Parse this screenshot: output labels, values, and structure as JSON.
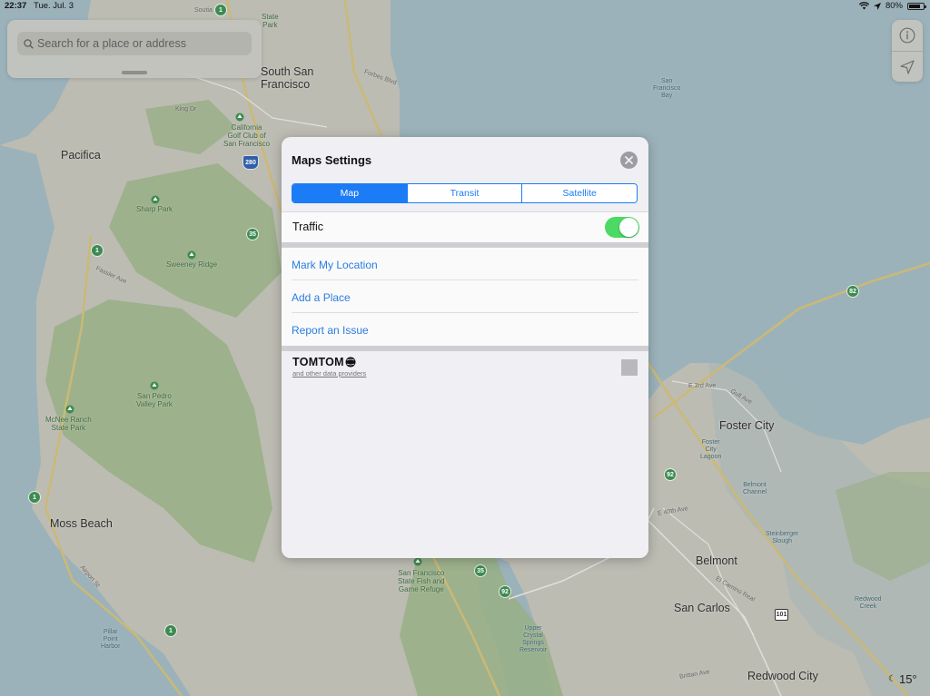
{
  "status_bar": {
    "time": "22:37",
    "date": "Tue. Jul. 3",
    "battery": "80%",
    "battery_level": 0.8,
    "icons": [
      "wifi-icon",
      "location-arrow-icon",
      "battery-icon"
    ]
  },
  "search": {
    "placeholder": "Search for a place or address"
  },
  "map_controls": {
    "info_icon": "info-icon",
    "locate_icon": "location-arrow-icon"
  },
  "map": {
    "labels": {
      "south_san_francisco": "South San\nFrancisco",
      "state_park": "State\nPark",
      "pacifica": "Pacifica",
      "california_golf": "California\nGolf Club of\nSan Francisco",
      "sharp_park": "Sharp Park",
      "sweeney_ridge": "Sweeney Ridge",
      "san_pedro": "San Pedro\nValley Park",
      "mcnee": "McNee Ranch\nState Park",
      "moss_beach": "Moss Beach",
      "pillar_point": "Pillar\nPoint\nHarbor",
      "sf_bay": "San\nFrancisco\nBay",
      "foster_city": "Foster City",
      "belmont": "Belmont",
      "san_carlos": "San Carlos",
      "redwood_city": "Redwood City",
      "sf_refuge": "San Francisco\nState Fish and\nGame Refuge",
      "upper_crystal": "Upper\nCrystal\nSprings\nReservoir",
      "belmont_channel": "Belmont\nChannel",
      "steinberger": "Steinberger\nSlough",
      "redwood_creek": "Redwood\nCreek",
      "foster_lagoon": "Foster\nCity\nLagoon",
      "forbes": "Forbes Blvd",
      "king_dr": "King Dr",
      "fassler": "Fassler Ave",
      "airport": "Airport St",
      "e40th": "E 40th Ave",
      "el_camino": "El Camino Real",
      "gull": "Gull Ave",
      "e3rd": "E 3rd Ave",
      "brittan": "Brittan Ave",
      "soutia": "Soutia"
    },
    "route_shields": [
      "1",
      "1",
      "1",
      "1",
      "35",
      "35",
      "92",
      "92",
      "82"
    ],
    "highway_101": "101",
    "interstate_280": "280",
    "weather": "15°"
  },
  "settings": {
    "title": "Maps Settings",
    "close_icon": "close-icon",
    "segments": [
      {
        "label": "Map",
        "selected": true
      },
      {
        "label": "Transit",
        "selected": false
      },
      {
        "label": "Satellite",
        "selected": false
      }
    ],
    "traffic": {
      "label": "Traffic",
      "enabled": true
    },
    "actions": [
      "Mark My Location",
      "Add a Place",
      "Report an Issue"
    ],
    "attribution": {
      "brand": "TOMTOM",
      "providers": "and other data providers"
    },
    "colors": {
      "accent": "#1b7cf5",
      "toggle_on": "#4cd964"
    }
  }
}
